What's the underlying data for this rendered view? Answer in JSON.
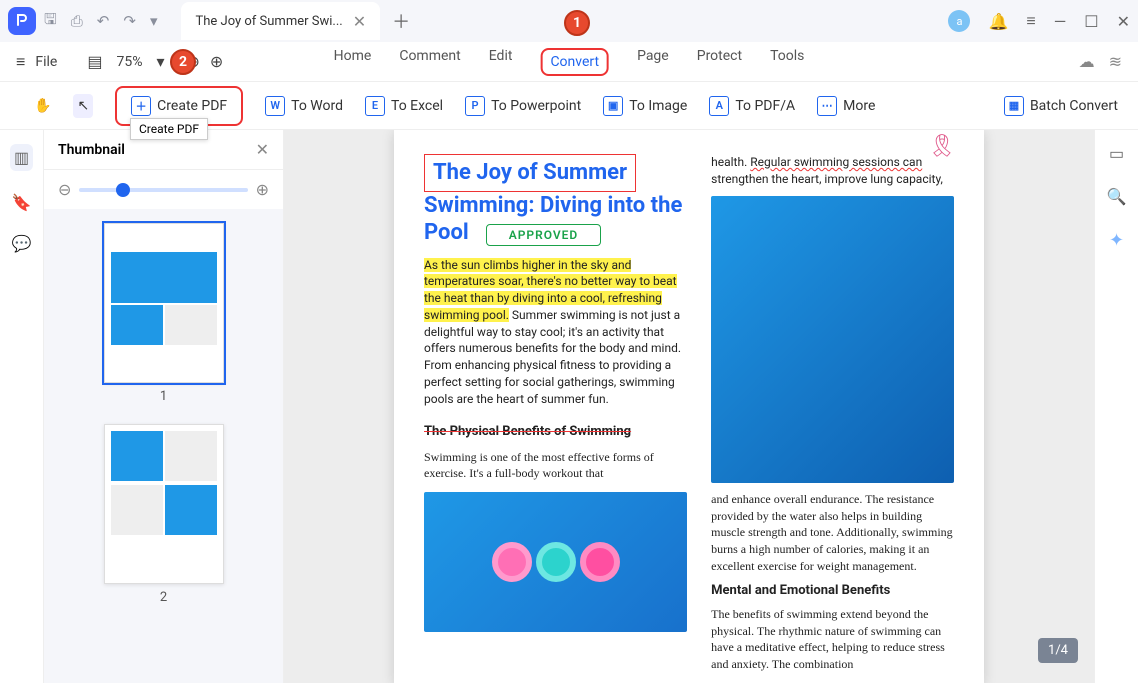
{
  "titlebar": {
    "tab_title": "The Joy of Summer Swi..."
  },
  "menubar": {
    "file": "File",
    "zoom": "75%",
    "items": [
      "Home",
      "Comment",
      "Edit",
      "Convert",
      "Page",
      "Protect",
      "Tools"
    ]
  },
  "toolbar": {
    "create_pdf": "Create PDF",
    "to_word": "To Word",
    "to_excel": "To Excel",
    "to_ppt": "To Powerpoint",
    "to_image": "To Image",
    "to_pdfa": "To PDF/A",
    "more": "More",
    "batch": "Batch Convert"
  },
  "tooltip": {
    "create_pdf": "Create PDF"
  },
  "thumbnail": {
    "title": "Thumbnail",
    "page1": "1",
    "page2": "2"
  },
  "callouts": {
    "c1": "1",
    "c2": "2"
  },
  "doc": {
    "title_l1": "The Joy of Summer",
    "title_rest": "Swimming: Diving into the Pool",
    "approved": "APPROVED",
    "intro_hl": "As the sun climbs higher in the sky and temperatures soar, there's no better way to beat the heat than by diving into a cool, refreshing swimming pool.",
    "intro_rest": " Summer swimming is not just a delightful way to stay cool; it's an activity that offers numerous benefits for the body and mind. From enhancing physical fitness to providing a perfect setting for social gatherings, swimming pools are the heart of summer fun.",
    "sec1": "The Physical Benefits of Swimming",
    "sec1_body": "Swimming is one of the most effective forms of exercise. It's a full-body workout that",
    "right_p1a": "health. ",
    "right_p1b": "Regular swimming sessions can",
    "right_p1c": " strengthen the heart, improve lung capacity,",
    "right_p2": "and enhance overall endurance. The resistance provided by the water also helps in building muscle strength and tone. Additionally, swimming burns a high number of calories, making it an excellent exercise for weight management.",
    "sec2": "Mental and Emotional Benefits",
    "sec2_body": "The benefits of swimming extend beyond the physical. The rhythmic nature of swimming can have a meditative effect, helping to reduce stress and anxiety. The combination "
  },
  "page_indicator": "1/4"
}
